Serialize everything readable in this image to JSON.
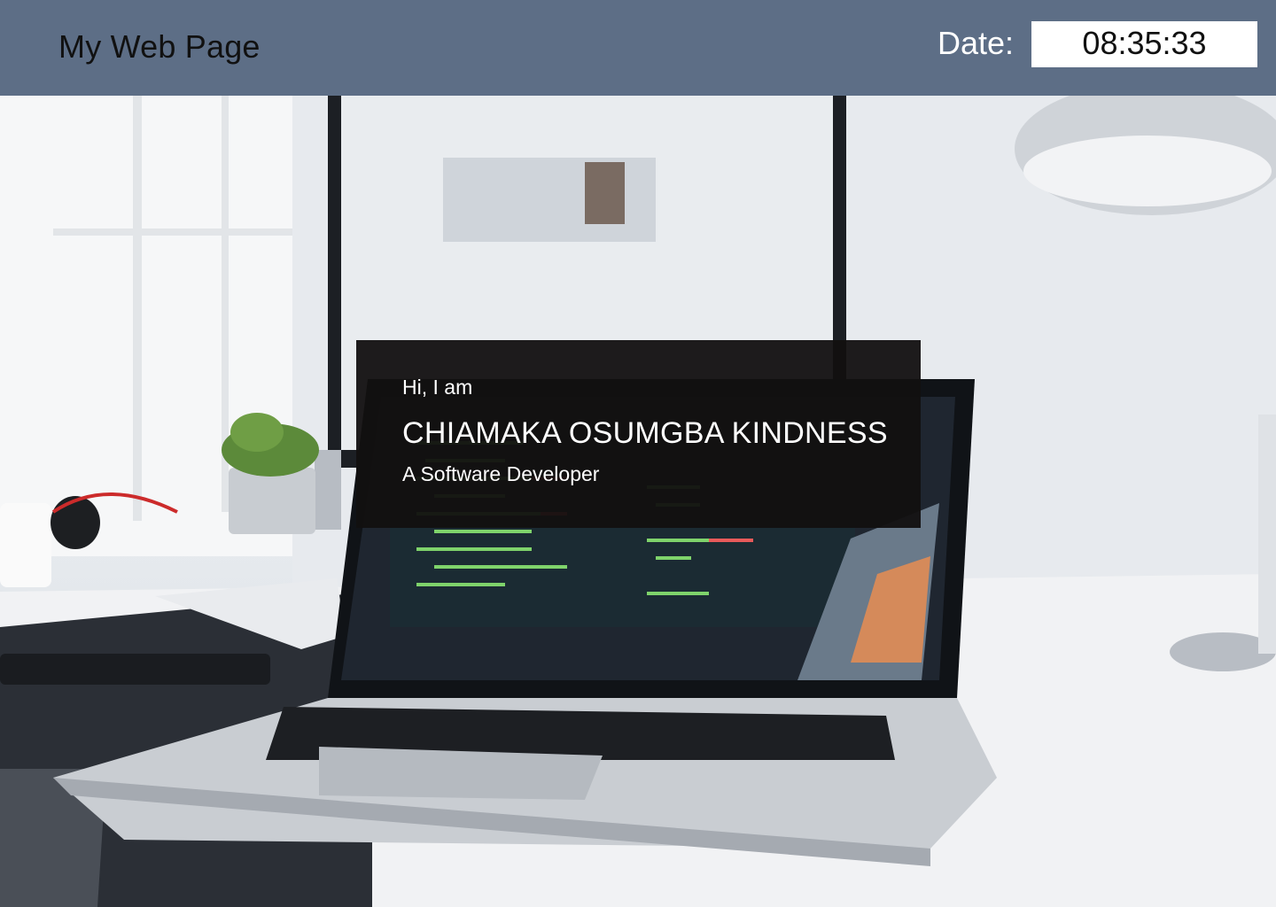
{
  "header": {
    "title": "My Web Page",
    "date_label": "Date:",
    "clock_value": "08:35:33"
  },
  "intro": {
    "greeting": "Hi, I am",
    "name": "CHIAMAKA OSUMGBA KINDNESS",
    "role": "A Software Developer"
  },
  "colors": {
    "header_bg": "#5d6e86",
    "card_bg": "#121010"
  }
}
